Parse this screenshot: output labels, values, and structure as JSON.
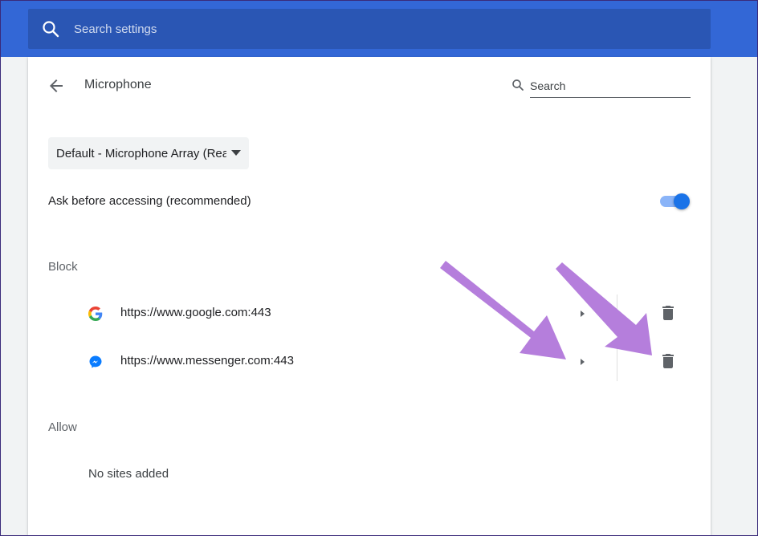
{
  "header": {
    "search_placeholder": "Search settings",
    "search_icon": "search-icon",
    "bar_color": "#3367d6"
  },
  "page": {
    "title": "Microphone",
    "back_icon": "arrow-back-icon",
    "search_placeholder": "Search"
  },
  "device_select": {
    "selected": "Default - Microphone Array (Realtek High Definition Audio)"
  },
  "ask_setting": {
    "label": "Ask before accessing (recommended)",
    "enabled": true,
    "accent_color": "#1a73e8"
  },
  "block": {
    "label": "Block",
    "sites": [
      {
        "url": "https://www.google.com:443",
        "favicon": "google-icon"
      },
      {
        "url": "https://www.messenger.com:443",
        "favicon": "messenger-icon"
      }
    ]
  },
  "allow": {
    "label": "Allow",
    "empty_text": "No sites added"
  },
  "annotations": {
    "arrow_color": "#b57edc"
  }
}
